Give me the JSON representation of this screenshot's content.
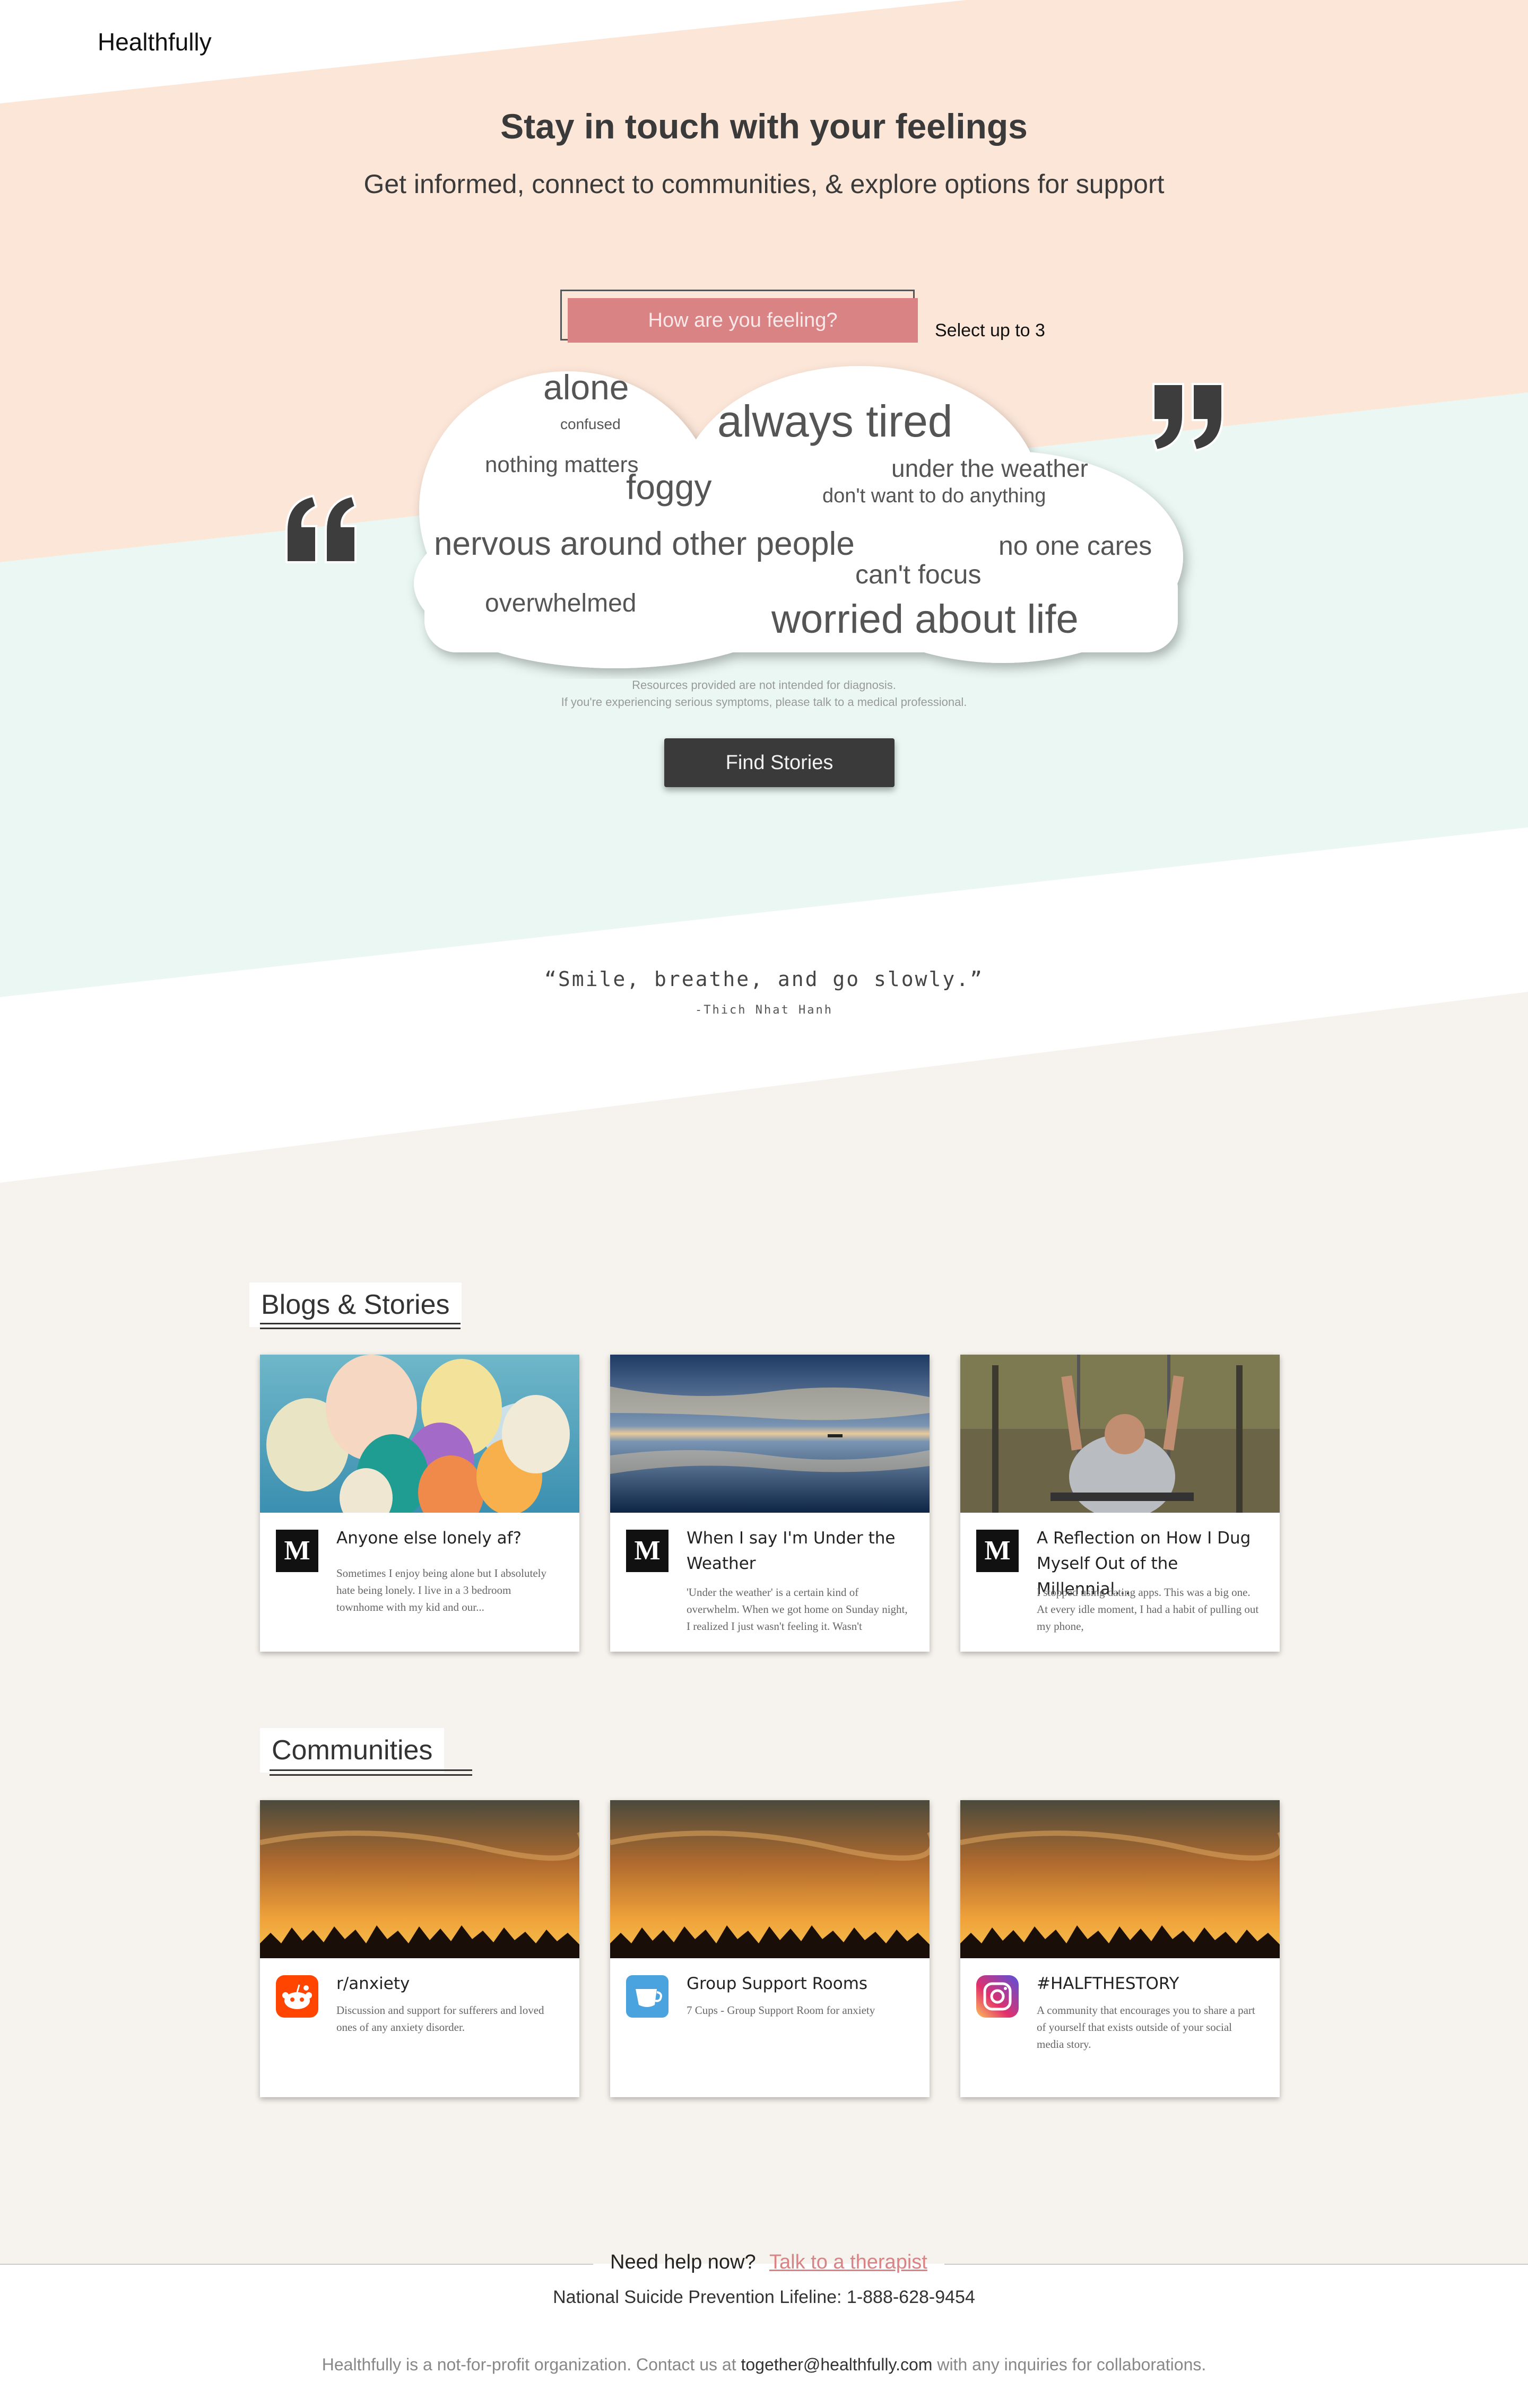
{
  "brand": {
    "name": "Healthfully"
  },
  "hero": {
    "title": "Stay in touch with your feelings",
    "subtitle": "Get informed, connect to communities, & explore options for support"
  },
  "feelings": {
    "prompt": "How are you feeling?",
    "select_note": "Select up to 3",
    "words": [
      "alone",
      "confused",
      "always tired",
      "nothing matters",
      "under the weather",
      "foggy",
      "don't want to do anything",
      "nervous around other people",
      "no one cares",
      "can't focus",
      "overwhelmed",
      "worried about life"
    ]
  },
  "disclaimer": {
    "line1": "Resources provided are not intended for diagnosis.",
    "line2": "If you're experiencing serious symptoms, please talk to a medical professional."
  },
  "find_button": "Find Stories",
  "quote": {
    "text": "“Smile, breathe, and go slowly.”",
    "author": "-Thich Nhat Hanh"
  },
  "blogs": {
    "heading": "Blogs & Stories",
    "cards": [
      {
        "icon": "medium-icon",
        "title": "Anyone else lonely af?",
        "text": "Sometimes I enjoy being alone but I absolutely hate being lonely. I live in a 3 bedroom townhome with my kid and our..."
      },
      {
        "icon": "medium-icon",
        "title": "When I say I'm Under the Weather",
        "text": "'Under the weather' is a certain kind of overwhelm. When we got home on Sunday night, I realized I just wasn't feeling it. Wasn't"
      },
      {
        "icon": "medium-icon",
        "title": "A Reflection on How I Dug Myself Out of the Millennial...",
        "text": "I stopped using dating apps. This was a big one. At every idle moment, I had a habit of pulling out my phone,"
      }
    ]
  },
  "communities": {
    "heading": "Communities",
    "cards": [
      {
        "icon": "reddit-icon",
        "title": "r/anxiety",
        "text": "Discussion and support for sufferers and loved ones of any anxiety disorder."
      },
      {
        "icon": "cups-icon",
        "title": "Group Support Rooms",
        "text": "7 Cups - Group Support Room for anxiety"
      },
      {
        "icon": "instagram-icon",
        "title": "#HALFTHESTORY",
        "text": "A community that encourages you to share a part of yourself that exists outside of your social media story."
      }
    ]
  },
  "footer": {
    "help": "Need help now?",
    "link": "Talk to a therapist",
    "lifeline": "National Suicide Prevention Lifeline: 1-888-628-9454",
    "org_before": "Healthfully is a not-for-profit organization. Contact us at",
    "email": "together@healthfully.com",
    "org_after": "with any inquiries for collaborations."
  },
  "colors": {
    "peach": "#fce6d8",
    "mint": "#eaf7f2",
    "cream": "#f6f2ed",
    "accent": "#d98384",
    "dark": "#3a3a3a"
  }
}
